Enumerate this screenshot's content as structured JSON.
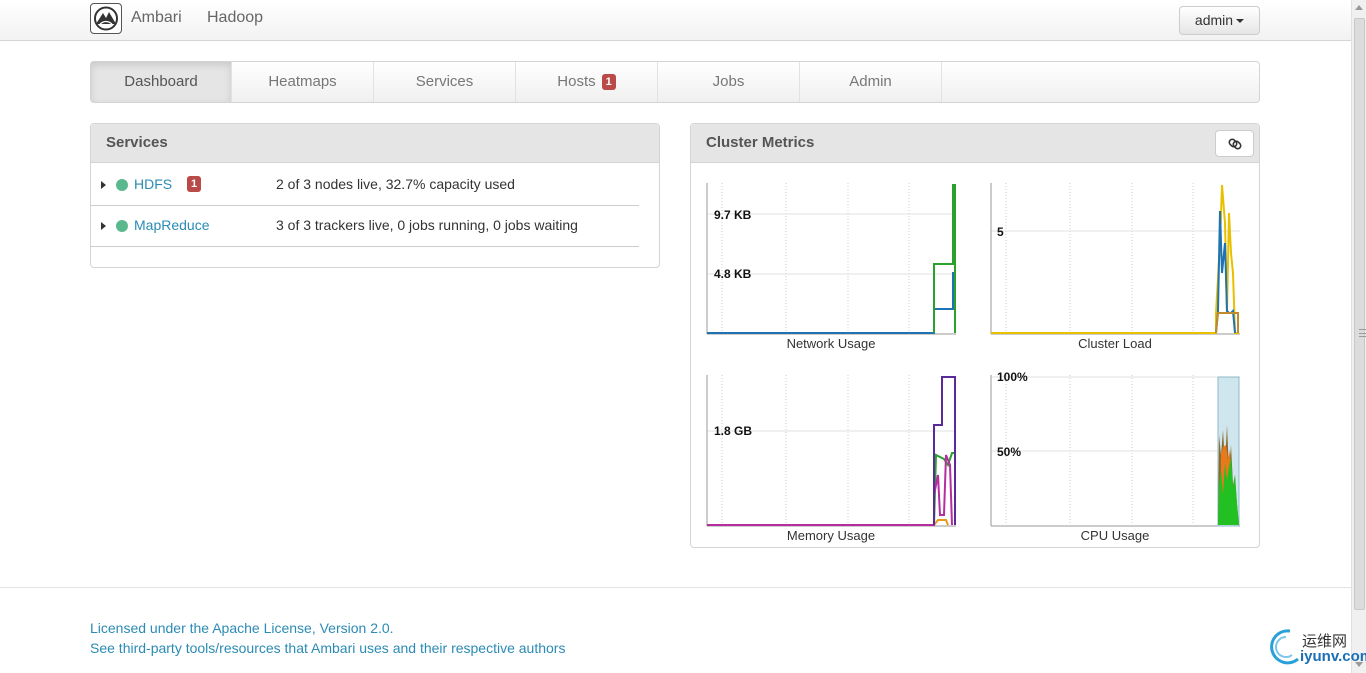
{
  "header": {
    "brand": "Ambari",
    "cluster_name": "Hadoop",
    "user_menu": "admin",
    "logo_icon": "ambari-logo-icon"
  },
  "tabs": [
    {
      "label": "Dashboard",
      "active": true
    },
    {
      "label": "Heatmaps"
    },
    {
      "label": "Services"
    },
    {
      "label": "Hosts",
      "badge": "1"
    },
    {
      "label": "Jobs"
    },
    {
      "label": "Admin"
    }
  ],
  "services_panel": {
    "title": "Services",
    "rows": [
      {
        "name": "HDFS",
        "badge": "1",
        "status": "2 of 3 nodes live, 32.7% capacity used",
        "status_color": "#5ab88f"
      },
      {
        "name": "MapReduce",
        "status": "3 of 3 trackers live, 0 jobs running, 0 jobs waiting",
        "status_color": "#5ab88f"
      }
    ]
  },
  "metrics_panel": {
    "title": "Cluster Metrics",
    "link_icon": "link-icon",
    "charts": [
      {
        "title": "Network Usage",
        "y_labels": [
          "9.7 KB",
          "4.8 KB"
        ]
      },
      {
        "title": "Cluster Load",
        "y_labels": [
          "5"
        ]
      },
      {
        "title": "Memory Usage",
        "y_labels": [
          "1.8 GB"
        ]
      },
      {
        "title": "CPU Usage",
        "y_labels": [
          "100%",
          "50%"
        ]
      }
    ]
  },
  "footer": {
    "license_link": "Licensed under the Apache License, Version 2.0.",
    "thirdparty_link": "See third-party tools/resources that Ambari uses and their respective authors"
  },
  "watermark": {
    "line1": "运维网",
    "line2": "iyunv.com"
  }
}
